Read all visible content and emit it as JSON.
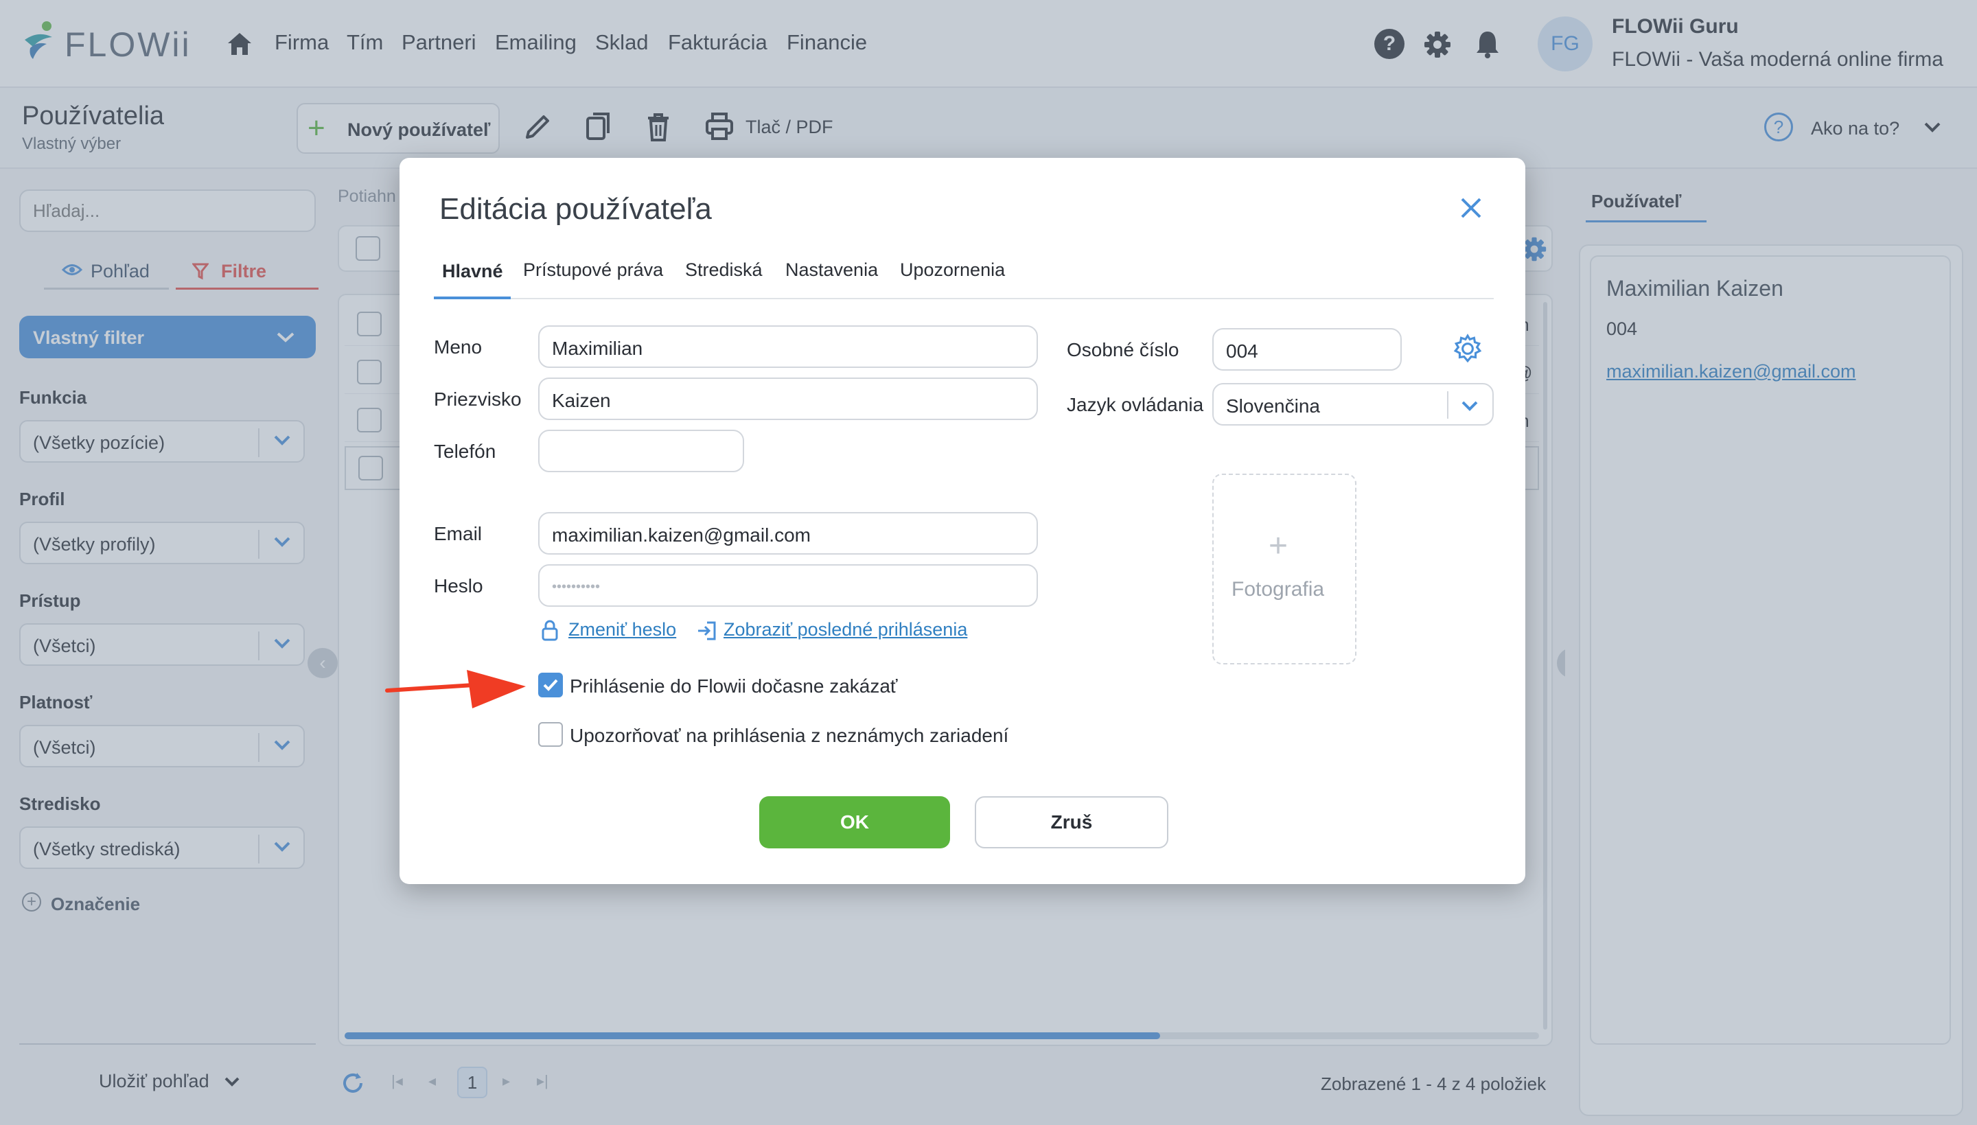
{
  "app": {
    "logo_text": "FLOWii",
    "nav": [
      "Firma",
      "Tím",
      "Partneri",
      "Emailing",
      "Sklad",
      "Fakturácia",
      "Financie"
    ],
    "user": {
      "initials": "FG",
      "name": "FLOWii Guru",
      "company": "FLOWii - Vaša moderná online firma"
    }
  },
  "toolbar": {
    "page_title": "Používatelia",
    "page_subtitle": "Vlastný výber",
    "new_user_label": "Nový používateľ",
    "print_label": "Tlač / PDF",
    "help_label": "Ako na to?"
  },
  "left_panel": {
    "search_placeholder": "Hľadaj...",
    "view_tab": "Pohľad",
    "filters_tab": "Filtre",
    "custom_filter": "Vlastný filter",
    "filters": [
      {
        "label": "Funkcia",
        "value": "(Všetky pozície)"
      },
      {
        "label": "Profil",
        "value": "(Všetky profily)"
      },
      {
        "label": "Prístup",
        "value": "(Všetci)"
      },
      {
        "label": "Platnosť",
        "value": "(Všetci)"
      },
      {
        "label": "Stredisko",
        "value": "(Všetky strediská)"
      }
    ],
    "tagging": "Označenie",
    "save_view": "Uložiť pohľad"
  },
  "center": {
    "drag_hint": "Potiahn",
    "row_fragments": [
      "m",
      "@",
      "m",
      "e"
    ],
    "pager_page": "1",
    "summary": "Zobrazené 1 - 4 z 4 položiek"
  },
  "right_panel": {
    "tab": "Používateľ",
    "name": "Maximilian Kaizen",
    "number": "004",
    "email": "maximilian.kaizen@gmail.com"
  },
  "dialog": {
    "title": "Editácia používateľa",
    "tabs": [
      "Hlavné",
      "Prístupové práva",
      "Strediská",
      "Nastavenia",
      "Upozornenia"
    ],
    "active_tab": "Hlavné",
    "fields": {
      "first_name": {
        "label": "Meno",
        "value": "Maximilian"
      },
      "last_name": {
        "label": "Priezvisko",
        "value": "Kaizen"
      },
      "phone": {
        "label": "Telefón",
        "value": ""
      },
      "email": {
        "label": "Email",
        "value": "maximilian.kaizen@gmail.com"
      },
      "password": {
        "label": "Heslo",
        "value": "••••••••••"
      },
      "personal_number": {
        "label": "Osobné číslo",
        "value": "004"
      },
      "language": {
        "label": "Jazyk ovládania",
        "value": "Slovenčina"
      }
    },
    "change_password": "Zmeniť heslo",
    "show_last_logins": "Zobraziť posledné prihlásenia",
    "photo_label": "Fotografia",
    "checkboxes": [
      {
        "label": "Prihlásenie do Flowii dočasne zakázať",
        "checked": true
      },
      {
        "label": "Upozorňovať na prihlásenia z neznámych zariadení",
        "checked": false
      }
    ],
    "ok_label": "OK",
    "cancel_label": "Zruš"
  },
  "colors": {
    "accent_blue": "#4a90d9",
    "ok_green": "#5bb53d",
    "filter_red": "#e2504b",
    "arrow_red": "#f03c24"
  }
}
